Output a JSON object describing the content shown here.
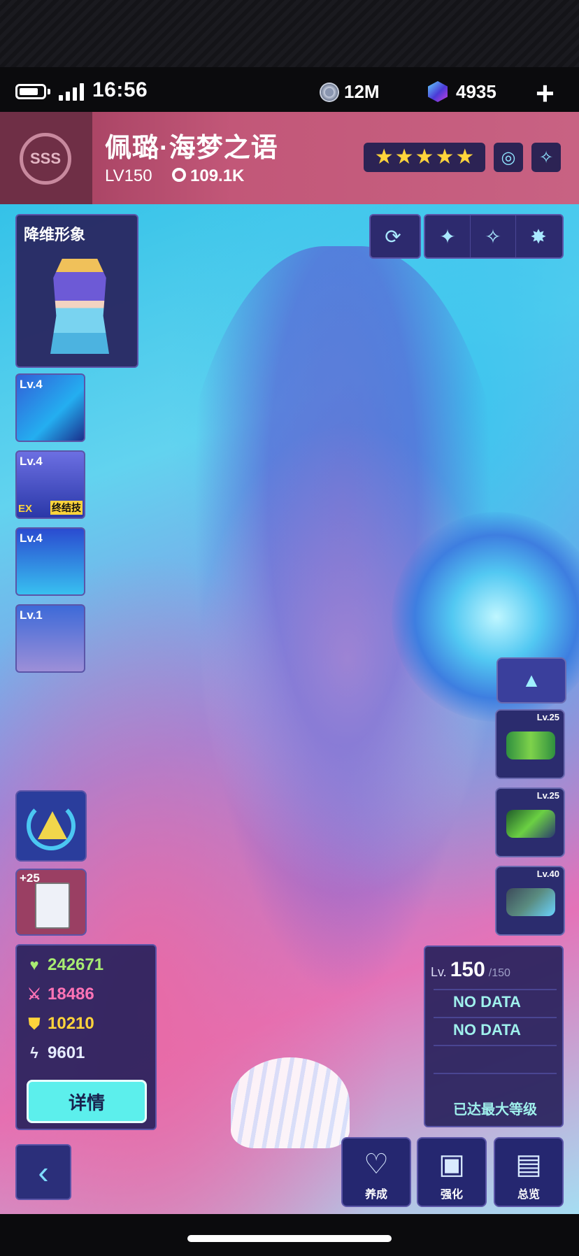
{
  "status_bar": {
    "time": "16:56",
    "coins": "12M",
    "gems": "4935",
    "add": "+"
  },
  "header": {
    "rank_badge": "SSS",
    "name": "佩璐·海梦之语",
    "level": "LV150",
    "power": "109.1K",
    "stars": 5,
    "star_glyph": "★"
  },
  "skin": {
    "title": "降维形象"
  },
  "skills": [
    {
      "level": "Lv.4"
    },
    {
      "level": "Lv.4",
      "tag": "EX",
      "ult": "终结技"
    },
    {
      "level": "Lv.4"
    },
    {
      "level": "Lv.1"
    }
  ],
  "item": {
    "bonus": "+25"
  },
  "stats": {
    "hp": "242671",
    "atk": "18486",
    "def": "10210",
    "spd": "9601",
    "detail_button": "详情"
  },
  "level_panel": {
    "prefix": "Lv.",
    "current": "150",
    "max": "/150",
    "line1": "NO DATA",
    "line2": "NO DATA",
    "footer": "已达最大等级"
  },
  "equipment": [
    {
      "level": "Lv.25"
    },
    {
      "level": "Lv.25"
    },
    {
      "level": "Lv.40"
    }
  ],
  "nav": {
    "cultivate": "养成",
    "enhance": "强化",
    "overview": "总览"
  },
  "colors": {
    "accent": "#5cefec",
    "header": "#c25778",
    "panel": "#28225c"
  },
  "icons": {
    "coin": "coin-icon",
    "gem": "gem-icon",
    "refresh": "refresh-icon",
    "sparkle": "sparkle-icon",
    "back": "back-arrow-icon"
  }
}
